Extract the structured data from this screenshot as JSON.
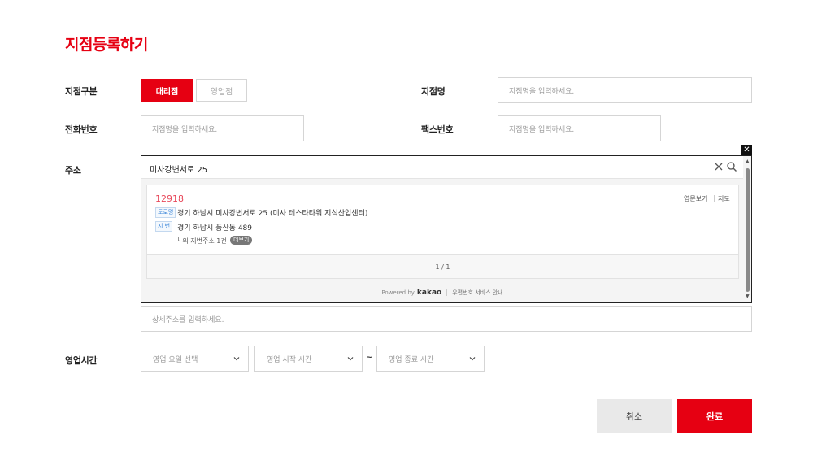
{
  "page": {
    "title": "지점등록하기"
  },
  "branch_type": {
    "label": "지점구분",
    "options": [
      "대리점",
      "영업점"
    ],
    "selected": "대리점"
  },
  "branch_name": {
    "label": "지점명",
    "placeholder": "지점명을 입력하세요."
  },
  "phone": {
    "label": "전화번호",
    "placeholder": "지점명을 입력하세요."
  },
  "fax": {
    "label": "팩스번호",
    "placeholder": "지점명을 입력하세요."
  },
  "address": {
    "label": "주소",
    "search_value": "미사강변서로 25",
    "result": {
      "zipcode": "12918",
      "road_badge": "도로명",
      "road_address": "경기 하남시 미사강변서로 25 (미사 테스타타워 지식산업센터)",
      "lot_badge": "지 번",
      "lot_address": "경기 하남시 풍산동 489",
      "other_lots": "└ 외 지번주소 1건",
      "more_label": "더보기",
      "english_link": "영문보기",
      "map_link": "지도"
    },
    "pagination": "1 / 1",
    "footer": {
      "powered_by": "Powered by",
      "brand": "kakao",
      "service_link": "우편번호 서비스 안내"
    },
    "detail_placeholder": "상세주소를 입력하세요."
  },
  "hours": {
    "label": "영업시간",
    "day_select": "영업 요일 선택",
    "start_select": "영업 시작 시간",
    "separator": "~",
    "end_select": "영업 종료 시간"
  },
  "actions": {
    "cancel": "취소",
    "done": "완료"
  },
  "colors": {
    "accent": "#e60012",
    "zip": "#e8485a",
    "badge": "#3b86d9"
  },
  "icons": [
    "clear-icon",
    "search-icon",
    "close-icon",
    "chevron-down-icon"
  ]
}
